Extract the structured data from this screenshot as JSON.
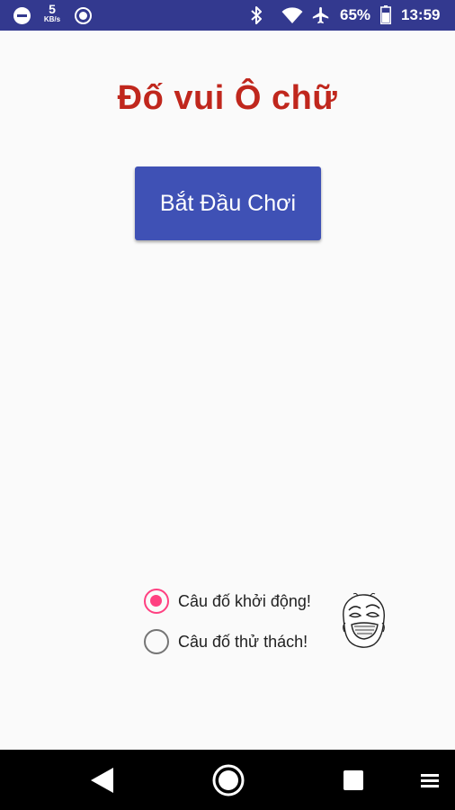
{
  "status_bar": {
    "net_speed_value": "5",
    "net_speed_unit": "KB/s",
    "battery_percent": "65%",
    "time": "13:59",
    "icons": [
      "do-not-disturb-icon",
      "sync-icon",
      "bluetooth-icon",
      "wifi-icon",
      "airplane-mode-icon",
      "battery-icon"
    ],
    "background_color": "#33398f"
  },
  "app": {
    "title": "Đố vui Ô chữ",
    "title_color": "#c0271d",
    "start_button_label": "Bắt Đầu Chơi",
    "start_button_color": "#3f51b5"
  },
  "mode_options": [
    {
      "label": "Câu đố khởi động!",
      "selected": true
    },
    {
      "label": "Câu đố thử thách!",
      "selected": false
    }
  ],
  "accent_color": "#ff4081",
  "nav_bar": {
    "icons": [
      "back-icon",
      "home-icon",
      "recents-icon",
      "menu-icon"
    ]
  }
}
